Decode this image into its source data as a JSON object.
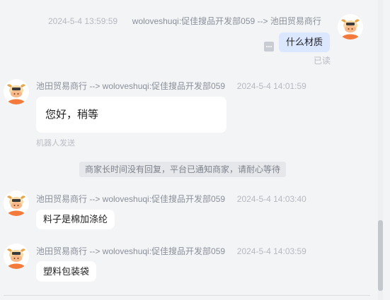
{
  "messages": [
    {
      "time": "2024-5-4 13:59:59",
      "route": "woloveshuqi:促佳搜品开发部059 --> 池田贸易商行",
      "text": "什么材质",
      "status": "已读"
    },
    {
      "route": "池田贸易商行 --> woloveshuqi:促佳搜品开发部059",
      "time": "2024-5-4 14:01:59",
      "text": "您好，稍等",
      "note": "机器人发送"
    },
    {
      "system": "商家长时间没有回复，平台已通知商家，请耐心等待"
    },
    {
      "route": "池田贸易商行 --> woloveshuqi:促佳搜品开发部059",
      "time": "2024-5-4 14:03:40",
      "text": "料子是棉加涤纶"
    },
    {
      "route": "池田贸易商行 --> woloveshuqi:促佳搜品开发部059",
      "time": "2024-5-4 14:03:59",
      "text": "塑料包装袋"
    }
  ],
  "icons": {
    "avatar": "cartoon-bull-avatar",
    "menu": "more-icon"
  },
  "colors": {
    "background": "#f3f4f6",
    "sent_bubble": "#dbe7ff",
    "received_bubble": "#ffffff",
    "avatar_orange": "#f47a3c",
    "horn": "#e8a64a"
  }
}
